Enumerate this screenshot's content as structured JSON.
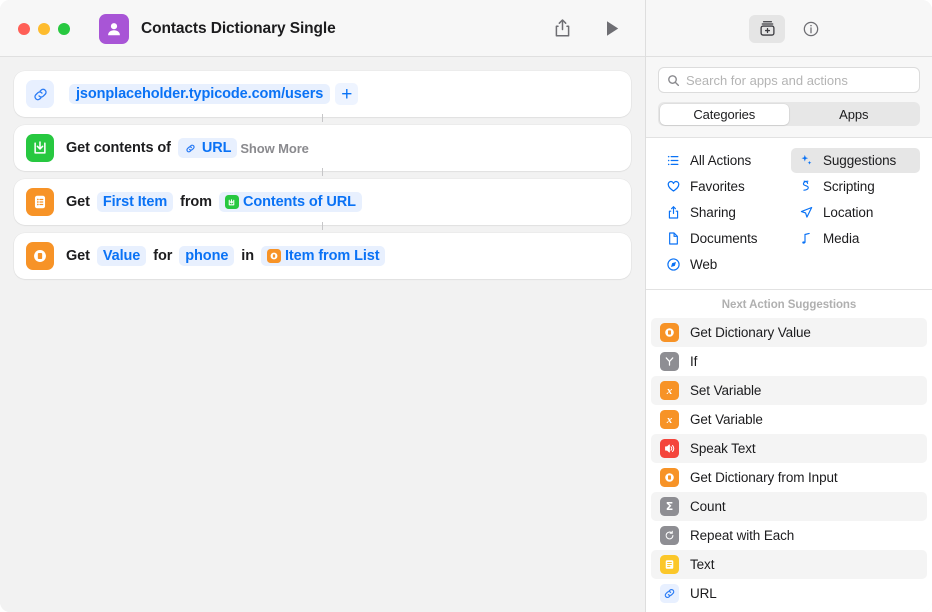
{
  "window": {
    "title": "Contacts Dictionary Single",
    "app_icon": "contacts-person-icon",
    "traffic_lights": [
      "close",
      "minimize",
      "zoom"
    ]
  },
  "toolbar": {
    "share_label": "share-icon",
    "run_label": "play-icon"
  },
  "actions": [
    {
      "icon": "url-link-icon",
      "icon_style": "link",
      "parts": [
        {
          "type": "token",
          "text": "jsonplaceholder.typicode.com/users"
        },
        {
          "type": "plus",
          "text": "+"
        }
      ],
      "trailing": ""
    },
    {
      "icon": "get-contents-icon",
      "icon_style": "green",
      "parts": [
        {
          "type": "word",
          "text": "Get contents of"
        },
        {
          "type": "token",
          "text": "URL",
          "token_icon": "link-glyph"
        }
      ],
      "trailing": "Show More"
    },
    {
      "icon": "get-item-from-list-icon",
      "icon_style": "orange",
      "parts": [
        {
          "type": "word",
          "text": "Get"
        },
        {
          "type": "token",
          "text": "First Item"
        },
        {
          "type": "word",
          "text": "from"
        },
        {
          "type": "token",
          "text": "Contents of URL",
          "token_icon": "green-contents-glyph"
        }
      ],
      "trailing": ""
    },
    {
      "icon": "get-dictionary-value-icon",
      "icon_style": "orange",
      "parts": [
        {
          "type": "word",
          "text": "Get"
        },
        {
          "type": "token",
          "text": "Value"
        },
        {
          "type": "word",
          "text": "for"
        },
        {
          "type": "token",
          "text": "phone"
        },
        {
          "type": "word",
          "text": "in"
        },
        {
          "type": "token",
          "text": "Item from List",
          "token_icon": "orange-dict-glyph"
        }
      ],
      "trailing": ""
    }
  ],
  "library": {
    "toolbar": {
      "action_library_icon": "add-action-library-icon",
      "info_icon": "info-circle-icon"
    },
    "search": {
      "placeholder": "Search for apps and actions",
      "value": "",
      "icon": "search-icon"
    },
    "segments": [
      {
        "label": "Categories",
        "selected": true
      },
      {
        "label": "Apps",
        "selected": false
      }
    ],
    "categories": [
      {
        "label": "All Actions",
        "icon": "list-bullet-icon",
        "selected": false
      },
      {
        "label": "Suggestions",
        "icon": "sparkles-icon",
        "selected": true
      },
      {
        "label": "Favorites",
        "icon": "heart-icon",
        "selected": false
      },
      {
        "label": "Scripting",
        "icon": "scripting-icon",
        "selected": false
      },
      {
        "label": "Sharing",
        "icon": "share-icon",
        "selected": false
      },
      {
        "label": "Location",
        "icon": "location-arrow-icon",
        "selected": false
      },
      {
        "label": "Documents",
        "icon": "document-icon",
        "selected": false
      },
      {
        "label": "Media",
        "icon": "music-note-icon",
        "selected": false
      },
      {
        "label": "Web",
        "icon": "safari-compass-icon",
        "selected": false
      }
    ],
    "suggestions_header": "Next Action Suggestions",
    "suggestions": [
      {
        "label": "Get Dictionary Value",
        "icon": "dictionary-icon",
        "color": "orange",
        "glyph": "dict",
        "alt": true
      },
      {
        "label": "If",
        "icon": "if-branch-icon",
        "color": "gray",
        "glyph": "if",
        "alt": false
      },
      {
        "label": "Set Variable",
        "icon": "variable-icon",
        "color": "orange",
        "glyph": "x",
        "alt": true
      },
      {
        "label": "Get Variable",
        "icon": "variable-icon",
        "color": "orange",
        "glyph": "x",
        "alt": false
      },
      {
        "label": "Speak Text",
        "icon": "speaker-icon",
        "color": "red",
        "glyph": "spk",
        "alt": true
      },
      {
        "label": "Get Dictionary from Input",
        "icon": "dictionary-icon",
        "color": "orange",
        "glyph": "dict",
        "alt": false
      },
      {
        "label": "Count",
        "icon": "sigma-icon",
        "color": "gray",
        "glyph": "sigma",
        "alt": true
      },
      {
        "label": "Repeat with Each",
        "icon": "repeat-icon",
        "color": "gray",
        "glyph": "rep",
        "alt": false
      },
      {
        "label": "Text",
        "icon": "text-lines-icon",
        "color": "yellow",
        "glyph": "lines",
        "alt": true
      },
      {
        "label": "URL",
        "icon": "url-link-icon",
        "color": "lblue",
        "glyph": "link",
        "alt": false
      }
    ]
  }
}
